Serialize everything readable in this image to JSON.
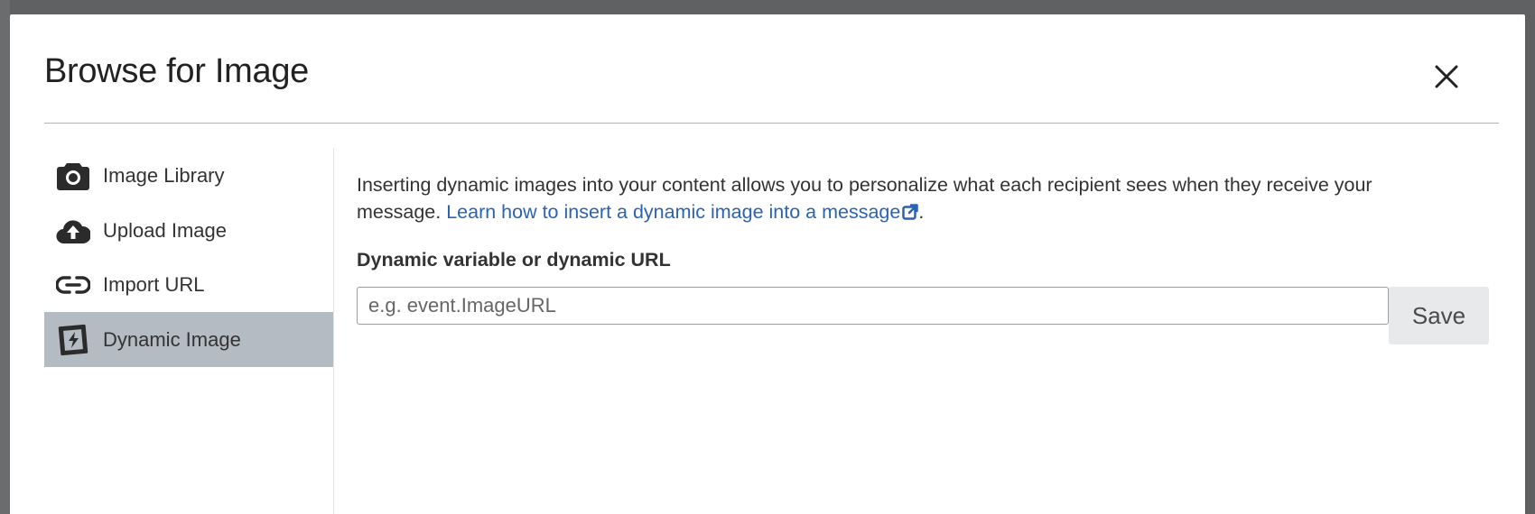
{
  "dialog": {
    "title": "Browse for Image",
    "close_icon": "close-icon"
  },
  "sidebar": {
    "items": [
      {
        "label": "Image Library",
        "icon": "camera-icon",
        "active": false
      },
      {
        "label": "Upload Image",
        "icon": "cloud-upload-icon",
        "active": false
      },
      {
        "label": "Import URL",
        "icon": "link-icon",
        "active": false
      },
      {
        "label": "Dynamic Image",
        "icon": "dynamic-image-icon",
        "active": true
      }
    ]
  },
  "content": {
    "description_text": "Inserting dynamic images into your content allows you to personalize what each recipient sees when they receive your message.",
    "help_link_text": "Learn how to insert a dynamic image into a message",
    "help_link_suffix": ".",
    "field_label": "Dynamic variable or dynamic URL",
    "input_value": "",
    "input_placeholder": "e.g. event.ImageURL",
    "save_label": "Save"
  },
  "colors": {
    "active_item_bg": "#b4bbc2",
    "link": "#2a63b3",
    "overlay": "#5f6062"
  }
}
